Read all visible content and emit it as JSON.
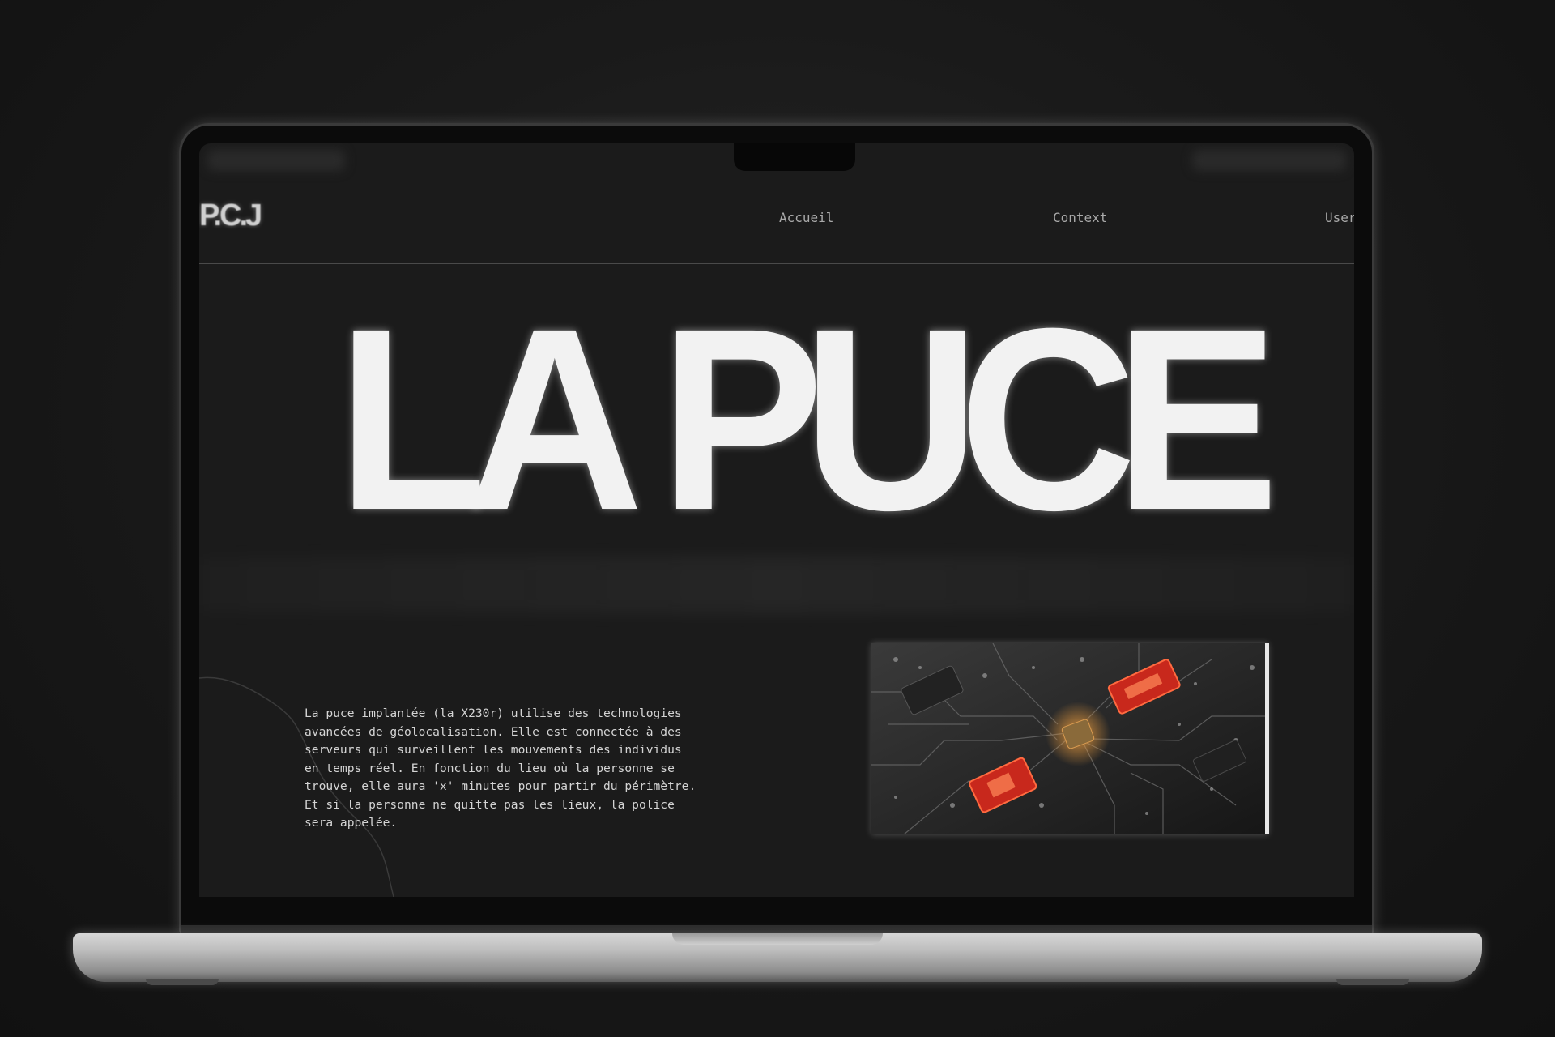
{
  "site": {
    "logo": "P.C.J",
    "nav": {
      "accueil": "Accueil",
      "context": "Context",
      "user": "User"
    }
  },
  "hero": {
    "title": "LA PUCE"
  },
  "content": {
    "paragraph": "La puce implantée (la X230r) utilise des technologies avancées de géolocalisation. Elle est connectée à des serveurs qui surveillent les mouvements des individus en temps réel. En fonction du lieu où la personne se trouve, elle aura 'x' minutes pour partir du périmètre. Et si la personne ne quitte pas les lieux, la police sera appelée."
  },
  "colors": {
    "background": "#151515",
    "screen": "#1b1b1b",
    "text": "#f2f2f2",
    "accent_red": "#d0281c"
  }
}
